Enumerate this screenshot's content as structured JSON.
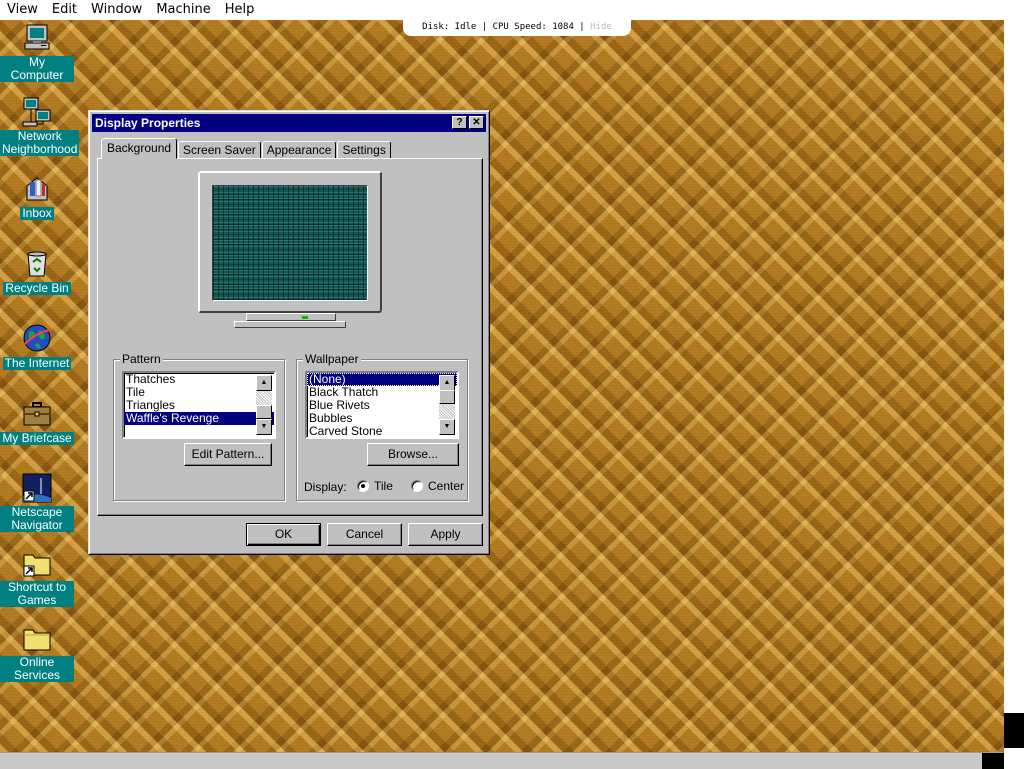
{
  "host": {
    "menu": [
      "View",
      "Edit",
      "Window",
      "Machine",
      "Help"
    ],
    "status": "Disk: Idle | CPU Speed: 1084 | ",
    "hide_label": "Hide"
  },
  "desktop_icons": [
    {
      "name": "My Computer",
      "icon": "computer-icon"
    },
    {
      "name": "Network Neighborhood",
      "icon": "network-icon"
    },
    {
      "name": "Inbox",
      "icon": "inbox-icon"
    },
    {
      "name": "Recycle Bin",
      "icon": "recycle-bin-icon"
    },
    {
      "name": "The Internet",
      "icon": "internet-icon"
    },
    {
      "name": "My Briefcase",
      "icon": "briefcase-icon"
    },
    {
      "name": "Netscape Navigator",
      "icon": "netscape-icon"
    },
    {
      "name": "Shortcut to Games",
      "icon": "folder-shortcut-icon"
    },
    {
      "name": "Online Services",
      "icon": "folder-icon"
    }
  ],
  "dialog": {
    "title": "Display Properties",
    "help_btn": "?",
    "close_btn": "✕",
    "tabs": [
      "Background",
      "Screen Saver",
      "Appearance",
      "Settings"
    ],
    "active_tab": "Background",
    "pattern": {
      "label": "Pattern",
      "items": [
        "Thatches",
        "Tile",
        "Triangles",
        "Waffle's Revenge"
      ],
      "selected": "Waffle's Revenge",
      "edit_button": "Edit Pattern..."
    },
    "wallpaper": {
      "label": "Wallpaper",
      "items": [
        "(None)",
        "Black Thatch",
        "Blue Rivets",
        "Bubbles",
        "Carved Stone"
      ],
      "selected": "(None)",
      "browse_button": "Browse...",
      "display_label": "Display:",
      "options": [
        "Tile",
        "Center"
      ],
      "selected_option": "Tile"
    },
    "buttons": {
      "ok": "OK",
      "cancel": "Cancel",
      "apply": "Apply"
    }
  },
  "colors": {
    "titlebar": "#000080",
    "face": "#c0c0c0",
    "icon_label_bg": "#008080",
    "desktop": "#a8741e"
  }
}
